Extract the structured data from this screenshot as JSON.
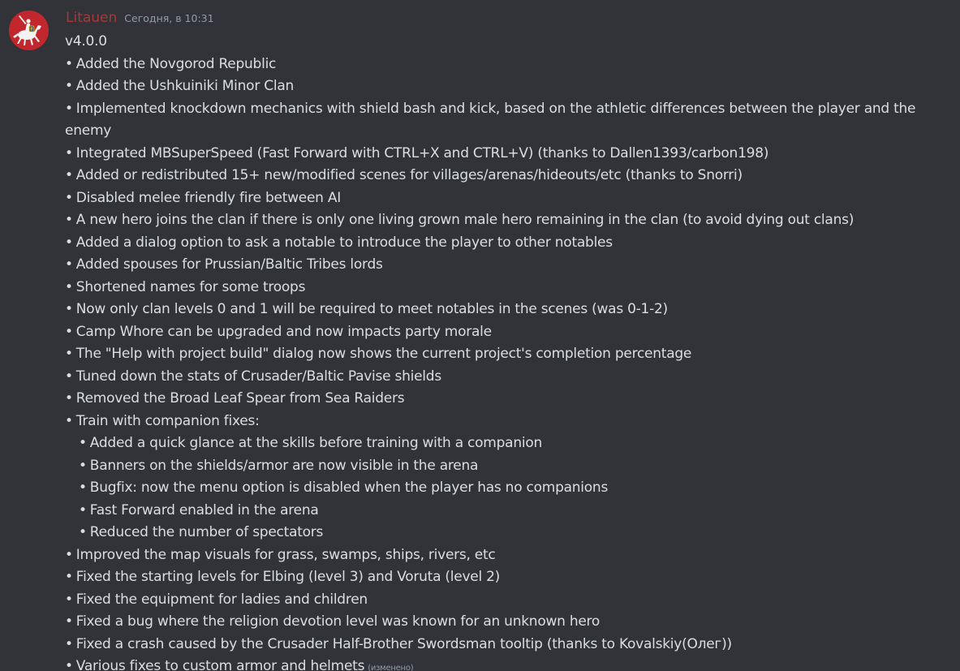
{
  "author": {
    "name": "Litauen",
    "avatar_icon": "vytis-knight-icon",
    "name_color": "#a63a3a"
  },
  "timestamp": "Сегодня, в 10:31",
  "version": "v4.0.0",
  "bullet": "•",
  "items": [
    "Added the Novgorod Republic",
    "Added the Ushkuiniki Minor Clan",
    "Implemented knockdown mechanics with shield bash and kick, based on the athletic differences between the player and the enemy",
    "Integrated MBSuperSpeed (Fast Forward with CTRL+X and CTRL+V) (thanks to Dallen1393/carbon198)",
    "Added or redistributed 15+ new/modified scenes for villages/arenas/hideouts/etc (thanks to Snorri)",
    "Disabled melee friendly fire between AI",
    "A new hero joins the clan if there is only one living grown male hero remaining in the clan (to avoid dying out clans)",
    "Added a dialog option to ask a notable to introduce the player to other notables",
    "Added spouses for Prussian/Baltic Tribes lords",
    "Shortened names for some troops",
    "Now only clan levels 0 and 1 will be required to meet notables in the scenes (was 0-1-2)",
    "Camp Whore can be upgraded and now impacts party morale",
    "The \"Help with project build\" dialog now shows the current project's completion percentage",
    "Tuned down the stats of Crusader/Baltic Pavise shields",
    "Removed the Broad Leaf Spear from Sea Raiders",
    "Train with companion fixes:"
  ],
  "sub_items": [
    "Added a quick glance at the skills before training with a companion",
    "Banners on the shields/armor are now visible in the arena",
    "Bugfix: now the menu option is disabled when the player has no companions",
    "Fast Forward enabled in the arena",
    "Reduced the number of spectators"
  ],
  "items_after": [
    "Improved the map visuals for grass, swamps, ships, rivers, etc",
    "Fixed the starting levels for Elbing (level 3) and Voruta (level 2)",
    "Fixed the equipment for ladies and children",
    "Fixed a bug where the religion devotion level was known for an unknown hero",
    "Fixed a crash caused by the Crusader Half-Brother Swordsman tooltip (thanks to Kovalskiy(Олег))",
    "Various fixes to custom armor and helmets"
  ],
  "edited_label": "(изменено)",
  "colors": {
    "background": "#313338",
    "text": "#dbdee1",
    "muted": "#949ba4"
  }
}
